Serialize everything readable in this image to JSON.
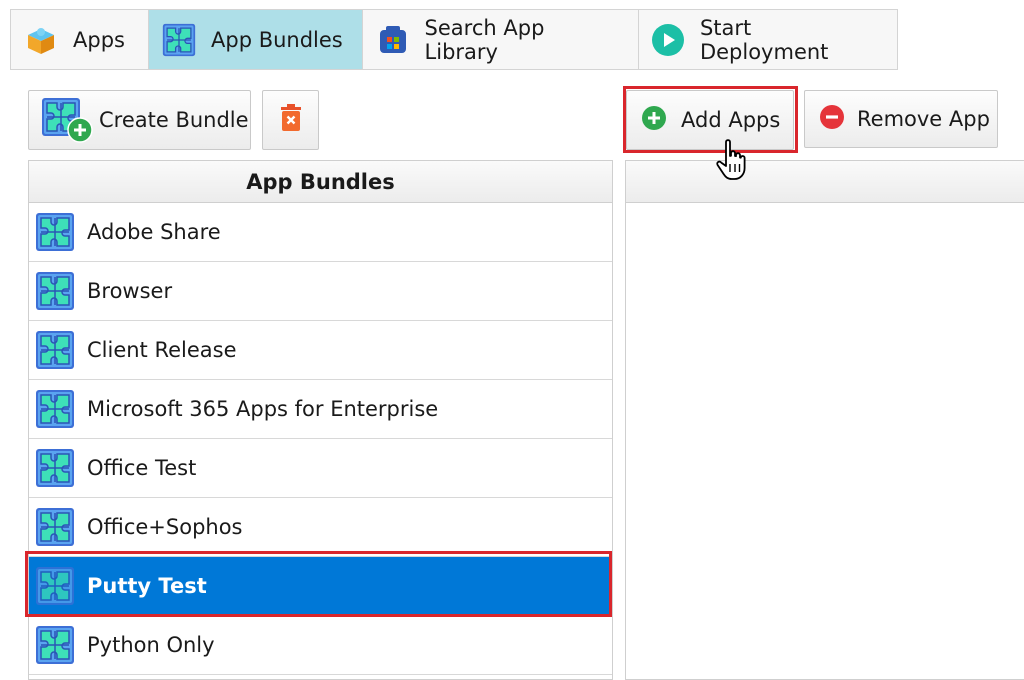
{
  "tabs": [
    {
      "label": "Apps",
      "icon": "apps-box-icon"
    },
    {
      "label": "App Bundles",
      "icon": "puzzle-icon",
      "active": true
    },
    {
      "label": "Search App Library",
      "icon": "library-icon"
    },
    {
      "label": "Start Deployment",
      "icon": "play-icon"
    }
  ],
  "toolbar": {
    "create_label": "Create Bundle",
    "add_label": "Add Apps",
    "remove_label": "Remove App"
  },
  "bundles": {
    "header": "App Bundles",
    "items": [
      "Adobe Share",
      "Browser",
      "Client Release",
      "Microsoft 365 Apps for Enterprise",
      "Office Test",
      "Office+Sophos",
      "Putty Test",
      "Python Only"
    ],
    "selected": "Putty Test"
  },
  "apps_panel": {
    "header": ""
  },
  "colors": {
    "active_tab": "#aedfe8",
    "selection": "#0078d7",
    "highlight": "#d9262c"
  }
}
